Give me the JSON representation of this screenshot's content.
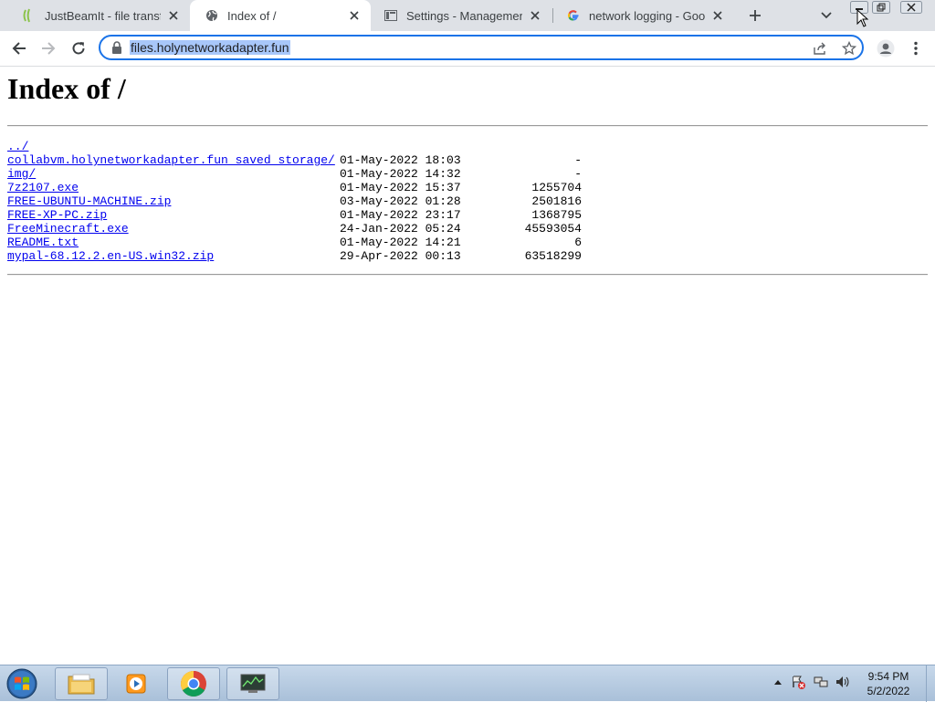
{
  "tabs": [
    {
      "title": "JustBeamIt - file transfer made easy",
      "icon": "justbeamit-icon"
    },
    {
      "title": "Index of /",
      "icon": "globe-icon",
      "active": true
    },
    {
      "title": "Settings - Management",
      "icon": "settings-page-icon"
    },
    {
      "title": "network logging - Google Search",
      "icon": "google-icon"
    }
  ],
  "omnibox": {
    "url": "files.holynetworkadapter.fun"
  },
  "page": {
    "heading": "Index of /",
    "entries": [
      {
        "name": "../",
        "date": "",
        "size": ""
      },
      {
        "name": "collabvm.holynetworkadapter.fun saved storage/",
        "date": "01-May-2022 18:03",
        "size": "-"
      },
      {
        "name": "img/",
        "date": "01-May-2022 14:32",
        "size": "-"
      },
      {
        "name": "7z2107.exe",
        "date": "01-May-2022 15:37",
        "size": "1255704"
      },
      {
        "name": "FREE-UBUNTU-MACHINE.zip",
        "date": "03-May-2022 01:28",
        "size": "2501816"
      },
      {
        "name": "FREE-XP-PC.zip",
        "date": "01-May-2022 23:17",
        "size": "1368795"
      },
      {
        "name": "FreeMinecraft.exe",
        "date": "24-Jan-2022 05:24",
        "size": "45593054"
      },
      {
        "name": "README.txt",
        "date": "01-May-2022 14:21",
        "size": "6"
      },
      {
        "name": "mypal-68.12.2.en-US.win32.zip",
        "date": "29-Apr-2022 00:13",
        "size": "63518299"
      }
    ]
  },
  "taskbar": {
    "time": "9:54 PM",
    "date": "5/2/2022"
  },
  "colors": {
    "accent": "#1a73e8",
    "link": "#0000ee",
    "selection": "#a8c7fa"
  }
}
